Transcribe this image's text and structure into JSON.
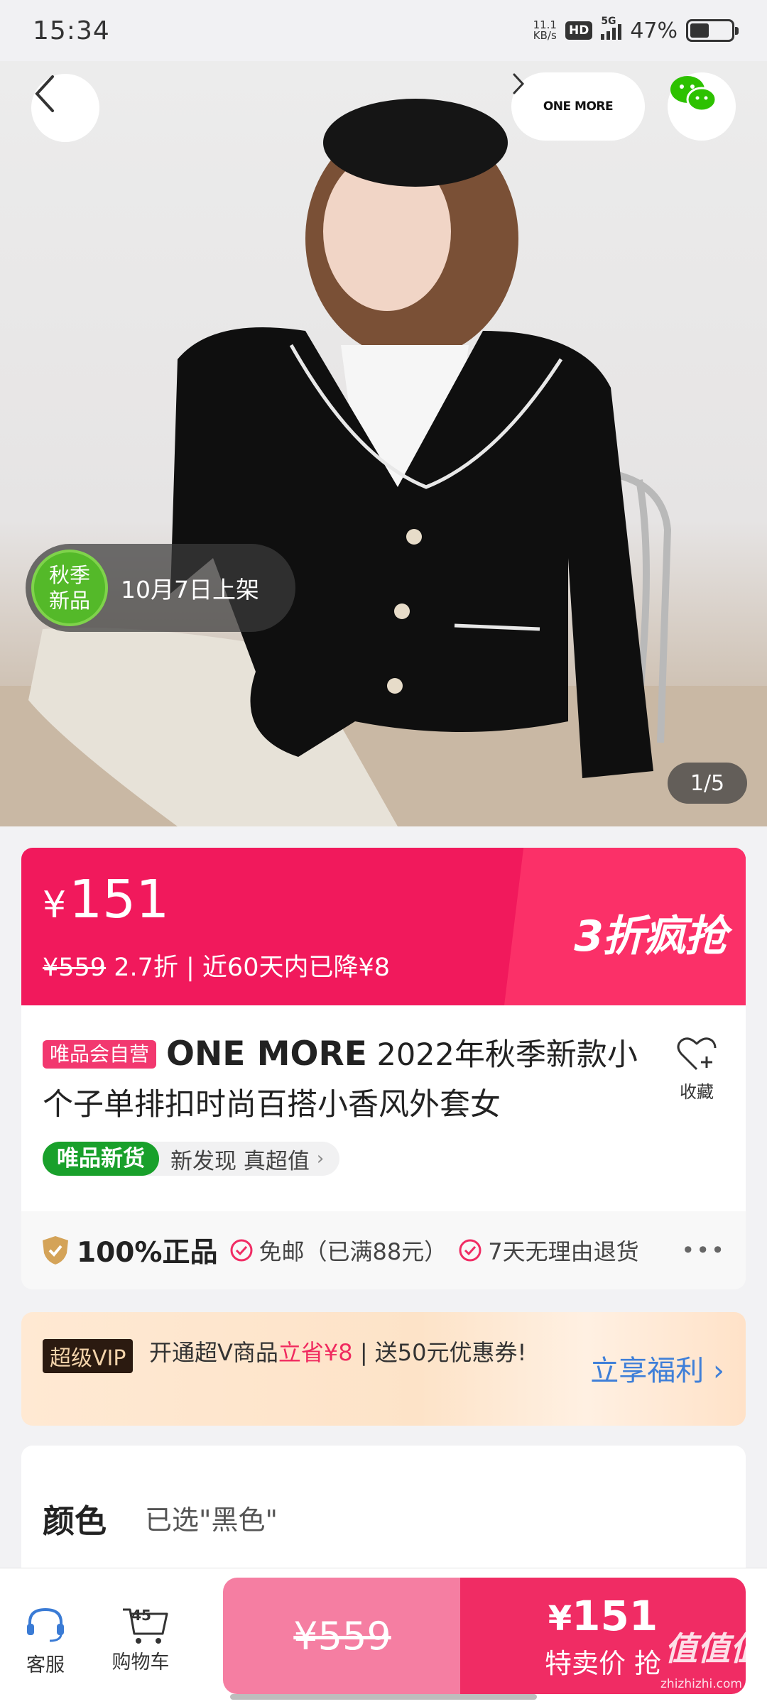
{
  "status_bar": {
    "time": "15:34",
    "net_speed_value": "11.1",
    "net_speed_unit": "KB/s",
    "hd": "HD",
    "network": "5G",
    "battery": "47%"
  },
  "hero": {
    "brand_name": "ONE MORE",
    "new_badge_line1": "秋季",
    "new_badge_line2": "新品",
    "launch_date": "10月7日上架",
    "page_indicator": "1/5"
  },
  "price_banner": {
    "currency": "¥",
    "price": "151",
    "original_price": "¥559",
    "discount_text": "2.7折 | 近60天内已降¥8",
    "promo": "3折疯抢"
  },
  "product": {
    "self_operated_tag": "唯品会自营",
    "brand": "ONE MORE",
    "title": " 2022年秋季新款小个子单排扣时尚百搭小香风外套女",
    "favorite_label": "收藏",
    "new_goods_tag": "唯品新货",
    "new_goods_text": "新发现 真超值",
    "guarantees": {
      "authentic": "100%正品",
      "free_shipping": "免邮（已满88元）",
      "returns": "7天无理由退货"
    }
  },
  "super_vip": {
    "badge": "超级VIP",
    "desc_prefix": "开通超V商品",
    "desc_highlight": "立省¥8",
    "desc_suffix": " | 送50元优惠券!",
    "cta": "立享福利"
  },
  "color": {
    "label": "颜色",
    "selected": "已选\"黑色\""
  },
  "bottom_bar": {
    "service_label": "客服",
    "cart_label": "购物车",
    "cart_count": "45",
    "original_price": "¥559",
    "special_price_currency": "¥",
    "special_price": "151",
    "special_label": "特卖价 抢",
    "watermark": "值值值",
    "watermark_url": "zhizhizhi.com"
  },
  "colors": {
    "accent_pink": "#f1195c",
    "vip_blue": "#3f7fd8",
    "new_green": "#19a02b"
  }
}
